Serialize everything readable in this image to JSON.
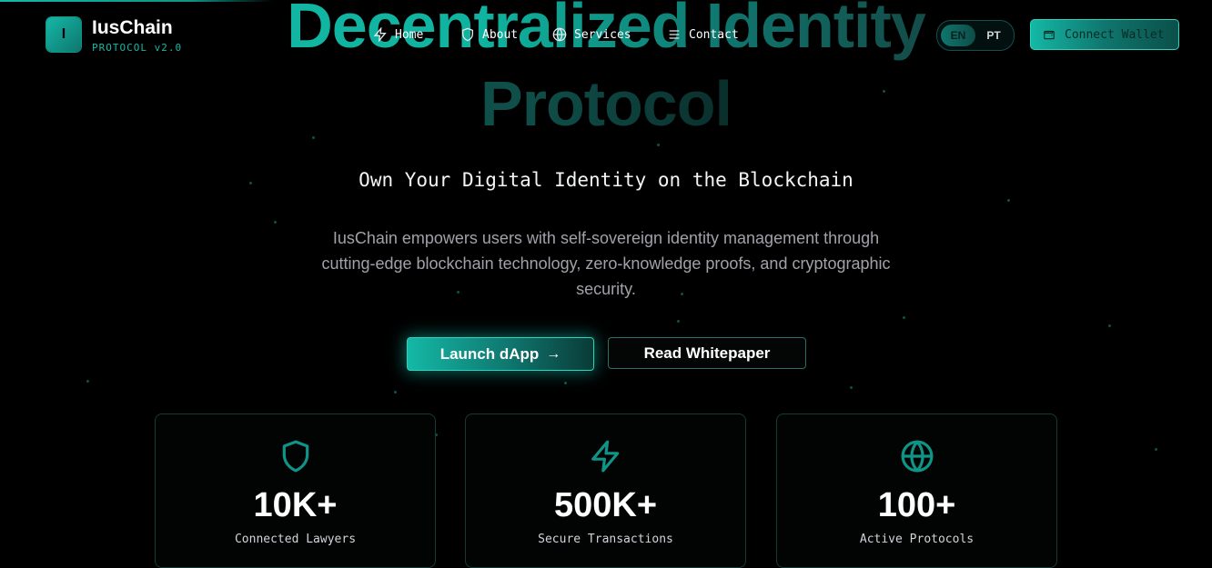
{
  "brand": {
    "name": "IusChain",
    "tagline": "PROTOCOL v2.0",
    "logo_letter": "I"
  },
  "nav": {
    "items": [
      {
        "label": "Home",
        "icon": "zap-icon"
      },
      {
        "label": "About",
        "icon": "shield-icon"
      },
      {
        "label": "Services",
        "icon": "globe-icon"
      },
      {
        "label": "Contact",
        "icon": "menu-icon"
      }
    ],
    "lang_en": "EN",
    "lang_pt": "PT",
    "connect_label": "Connect Wallet"
  },
  "hero": {
    "title_line1": "Decentralized Identity",
    "title_line2": "Protocol",
    "subtitle": "Own Your Digital Identity on the Blockchain",
    "description": "IusChain empowers users with self-sovereign identity management through cutting-edge blockchain technology, zero-knowledge proofs, and cryptographic security.",
    "launch_label": "Launch dApp",
    "whitepaper_label": "Read Whitepaper"
  },
  "stats": [
    {
      "value": "10K+",
      "label": "Connected Lawyers",
      "icon": "shield-icon"
    },
    {
      "value": "500K+",
      "label": "Secure Transactions",
      "icon": "zap-icon"
    },
    {
      "value": "100+",
      "label": "Active Protocols",
      "icon": "globe-icon"
    }
  ],
  "colors": {
    "accent": "#14b8a6",
    "accent_dark": "#0f766e",
    "background": "#000000"
  }
}
